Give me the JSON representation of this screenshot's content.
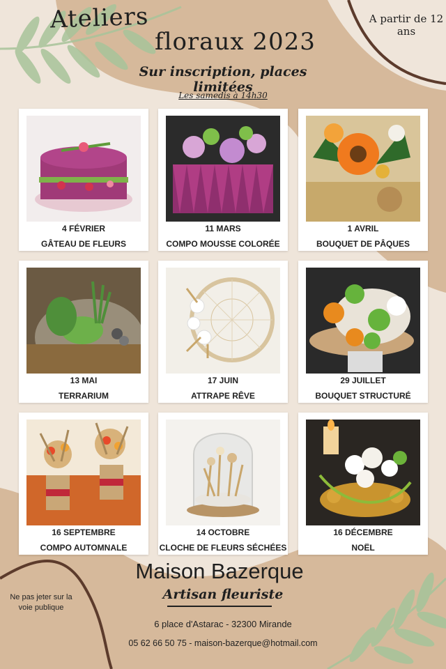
{
  "header": {
    "title_line1": "Ateliers",
    "title_line2": "floraux 2023",
    "subtitle": "Sur inscription, places limitées",
    "schedule": "Les samedis à 14h30",
    "age_note": "A partir de 12 ans"
  },
  "workshops": [
    {
      "date": "4 février",
      "name": "Gâteau de fleurs"
    },
    {
      "date": "11 mars",
      "name": "Compo mousse colorée"
    },
    {
      "date": "1 avril",
      "name": "Bouquet de Pâques"
    },
    {
      "date": "13 mai",
      "name": "Terrarium"
    },
    {
      "date": "17 juin",
      "name": "Attrape rêve"
    },
    {
      "date": "29 juillet",
      "name": "Bouquet structuré"
    },
    {
      "date": "16 septembre",
      "name": "Compo automnale"
    },
    {
      "date": "14 octobre",
      "name": "Cloche de fleurs séchées"
    },
    {
      "date": "16 décembre",
      "name": "Noël"
    }
  ],
  "footer": {
    "shop_name": "Maison Bazerque",
    "trade": "Artisan fleuriste",
    "address": "6 place d'Astarac - 32300 Mirande",
    "contact": "05 62 66 50 75 - maison-bazerque@hotmail.com",
    "notice": "Ne pas jeter sur la voie publique"
  },
  "colors": {
    "background": "#efe5da",
    "tan_shape": "#d6b99b",
    "leaf_green": "#a8c49a",
    "text": "#1f1f1f"
  }
}
